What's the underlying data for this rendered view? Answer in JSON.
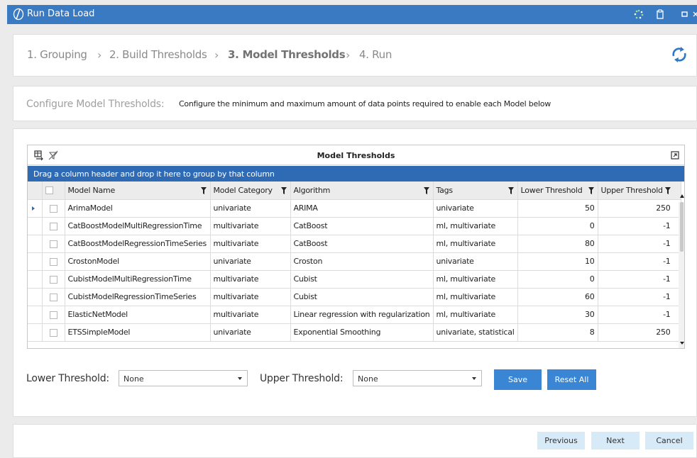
{
  "window": {
    "title": "Run Data Load"
  },
  "wizard": {
    "steps": [
      {
        "label": "1. Grouping"
      },
      {
        "label": "2. Build Thresholds"
      },
      {
        "label": "3. Model Thresholds"
      },
      {
        "label": "4. Run"
      }
    ],
    "active_step": 2
  },
  "config": {
    "label": "Configure Model Thresholds:",
    "description": "Configure the minimum and maximum amount of data points required to enable each Model below"
  },
  "grid": {
    "title": "Model Thresholds",
    "group_hint": "Drag a column header and drop it here to group by that column",
    "columns": [
      "Model Name",
      "Model Category",
      "Algorithm",
      "Tags",
      "Lower Threshold",
      "Upper Threshold"
    ],
    "rows": [
      {
        "model": "ArimaModel",
        "category": "univariate",
        "algorithm": "ARIMA",
        "tags": "univariate",
        "lower": "50",
        "upper": "250",
        "current": true
      },
      {
        "model": "CatBoostModelMultiRegressionTime",
        "category": "multivariate",
        "algorithm": "CatBoost",
        "tags": "ml, multivariate",
        "lower": "0",
        "upper": "-1"
      },
      {
        "model": "CatBoostModelRegressionTimeSeries",
        "category": "multivariate",
        "algorithm": "CatBoost",
        "tags": "ml, multivariate",
        "lower": "80",
        "upper": "-1"
      },
      {
        "model": "CrostonModel",
        "category": "univariate",
        "algorithm": "Croston",
        "tags": "univariate",
        "lower": "10",
        "upper": "-1"
      },
      {
        "model": "CubistModelMultiRegressionTime",
        "category": "multivariate",
        "algorithm": "Cubist",
        "tags": "ml, multivariate",
        "lower": "0",
        "upper": "-1"
      },
      {
        "model": "CubistModelRegressionTimeSeries",
        "category": "multivariate",
        "algorithm": "Cubist",
        "tags": "ml, multivariate",
        "lower": "60",
        "upper": "-1"
      },
      {
        "model": "ElasticNetModel",
        "category": "multivariate",
        "algorithm": "Linear regression with regularization",
        "tags": "ml, multivariate",
        "lower": "30",
        "upper": "-1"
      },
      {
        "model": "ETSSimpleModel",
        "category": "univariate",
        "algorithm": "Exponential Smoothing",
        "tags": "univariate, statistical",
        "lower": "8",
        "upper": "250"
      }
    ]
  },
  "thresholds": {
    "lower_label": "Lower Threshold:",
    "lower_value": "None",
    "upper_label": "Upper Threshold:",
    "upper_value": "None",
    "save_label": "Save",
    "reset_label": "Reset All"
  },
  "footer": {
    "previous_label": "Previous",
    "next_label": "Next",
    "cancel_label": "Cancel"
  },
  "colors": {
    "titlebar": "#3a7ac2",
    "group_bar": "#2f6ab5",
    "primary_button": "#3a86d4",
    "secondary_button": "#d7eaf8"
  }
}
